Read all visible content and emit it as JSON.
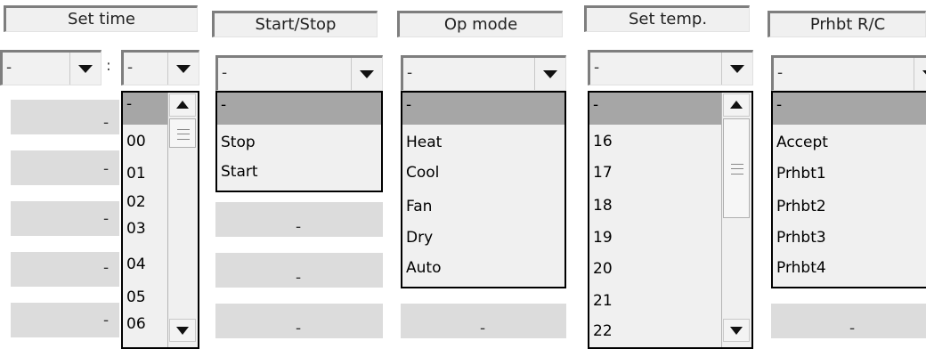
{
  "columns": {
    "set_time": {
      "header": "Set time",
      "hour_value": "-",
      "separator": ":",
      "minute_value": "-",
      "cells": [
        "-",
        "-",
        "-",
        "-",
        "-"
      ],
      "minute_options": [
        "-",
        "00",
        "01",
        "02",
        "03",
        "04",
        "05",
        "06"
      ],
      "selected_option": "-"
    },
    "start_stop": {
      "header": "Start/Stop",
      "value": "-",
      "options": [
        "-",
        "Stop",
        "Start"
      ],
      "selected_option": "-",
      "cells": [
        "-",
        "-",
        "-"
      ]
    },
    "op_mode": {
      "header": "Op mode",
      "value": "-",
      "options": [
        "-",
        "Heat",
        "Cool",
        "Fan",
        "Dry",
        "Auto"
      ],
      "selected_option": "-",
      "cells": [
        "-"
      ]
    },
    "set_temp": {
      "header": "Set temp.",
      "value": "-",
      "options": [
        "-",
        "16",
        "17",
        "18",
        "19",
        "20",
        "21",
        "22"
      ],
      "selected_option": "-"
    },
    "prhbt_rc": {
      "header": "Prhbt R/C",
      "value": "-",
      "options": [
        "-",
        "Accept",
        "Prhbt1",
        "Prhbt2",
        "Prhbt3",
        "Prhbt4"
      ],
      "selected_option": "-",
      "cells": [
        "-"
      ]
    }
  },
  "icons": {
    "dropdown": "triangle-down",
    "scroll_up": "triangle-up",
    "scroll_down": "triangle-down",
    "thumb_grip": "three-line-grip"
  },
  "colors": {
    "selection": "#a6a6a6",
    "cell_background": "#dcdcdc",
    "list_border": "#000000"
  }
}
